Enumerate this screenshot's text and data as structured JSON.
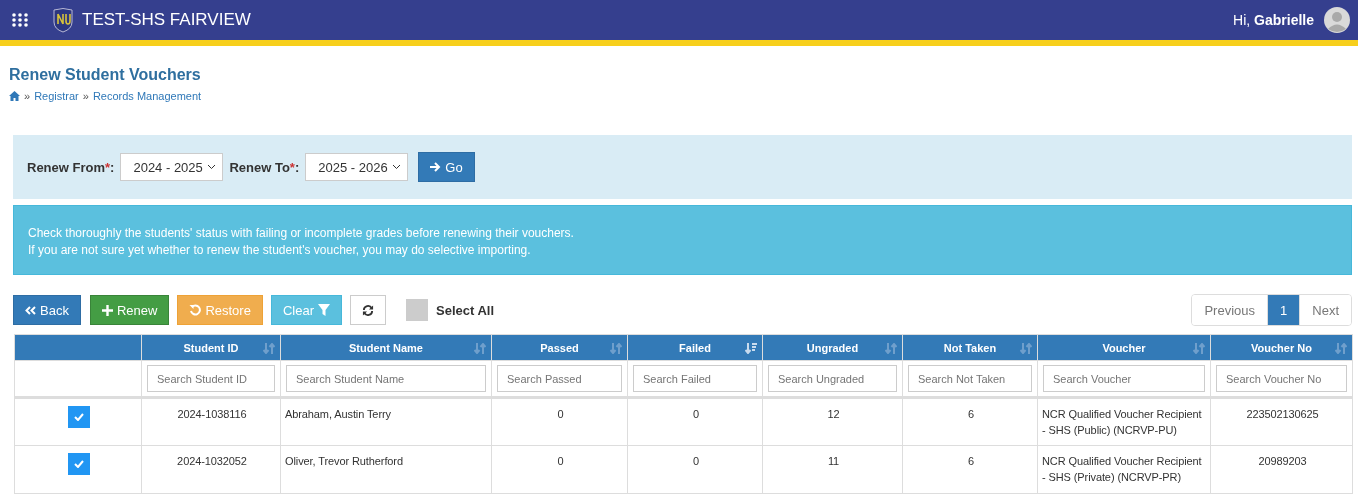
{
  "header": {
    "school": "TEST-SHS FAIRVIEW",
    "greeting": "Hi, **Gabrielle**"
  },
  "page": {
    "title": "Renew Student Vouchers",
    "breadcrumb_separator": "»",
    "breadcrumb": [
      "Registrar",
      "Records Management"
    ]
  },
  "filter": {
    "from_label": "Renew From",
    "from_value": "2024 - 2025",
    "to_label": "Renew To",
    "to_value": "2025 - 2026",
    "required_mark": "*",
    "label_suffix": ":",
    "go": "Go"
  },
  "alert": [
    "Check thoroughly the students' status with failing or incomplete grades before renewing their vouchers.",
    "If you are not sure yet whether to renew the student's voucher, you may do selective importing."
  ],
  "toolbar": {
    "back": "Back",
    "renew": "Renew",
    "restore": "Restore",
    "clear": "Clear",
    "select_all": {
      "label": "Select All",
      "checked": false
    }
  },
  "pagination": [
    {
      "label": "Previous",
      "selected": false
    },
    {
      "label": "1",
      "selected": true
    },
    {
      "label": "Next",
      "selected": false
    }
  ],
  "table": {
    "columns": [
      {
        "label": "Student ID",
        "placeholder": "Search Student ID",
        "sorted": false
      },
      {
        "label": "Student Name",
        "placeholder": "Search Student Name",
        "sorted": false
      },
      {
        "label": "Passed",
        "placeholder": "Search Passed",
        "sorted": false
      },
      {
        "label": "Failed",
        "placeholder": "Search Failed",
        "sorted": true
      },
      {
        "label": "Ungraded",
        "placeholder": "Search Ungraded",
        "sorted": false
      },
      {
        "label": "Not Taken",
        "placeholder": "Search Not Taken",
        "sorted": false
      },
      {
        "label": "Voucher",
        "placeholder": "Search Voucher",
        "sorted": false
      },
      {
        "label": "Voucher No",
        "placeholder": "Search Voucher No",
        "sorted": false
      }
    ],
    "rows": [
      {
        "checked": true,
        "cells": [
          "2024-1038116",
          "Abraham, Austin Terry",
          "0",
          "0",
          "12",
          "6",
          "NCR Qualified Voucher Recipient - SHS (Public) (NCRVP-PU)",
          "223502130625"
        ]
      },
      {
        "checked": true,
        "cells": [
          "2024-1032052",
          "Oliver, Trevor Rutherford",
          "0",
          "0",
          "11",
          "6",
          "NCR Qualified Voucher Recipient - SHS (Private) (NCRVP-PR)",
          "20989203"
        ]
      }
    ]
  }
}
